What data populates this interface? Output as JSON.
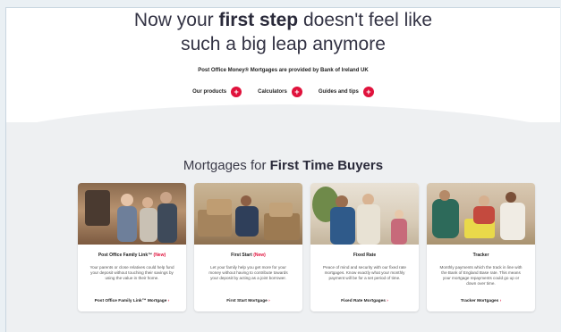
{
  "hero": {
    "title_part1": "Now your ",
    "title_bold": "first step",
    "title_part2": " doesn't feel like",
    "title_line2": "such a big leap anymore",
    "subtitle": "Post Office Money® Mortgages are provided by Bank of Ireland UK"
  },
  "links": [
    {
      "label": "Our products",
      "icon": "plus-icon"
    },
    {
      "label": "Calculators",
      "icon": "plus-icon"
    },
    {
      "label": "Guides and tips",
      "icon": "plus-icon"
    }
  ],
  "section": {
    "title_part1": "Mortgages for ",
    "title_bold": "First Time Buyers"
  },
  "cards": [
    {
      "title": "Post Office Family Link™",
      "tag": "(New)",
      "text": "Your parents or close relatives could help fund your deposit without touching their savings by using the value in their home.",
      "link": "Post Office Family Link™ Mortgage",
      "arrow": "›"
    },
    {
      "title": "First Start",
      "tag": "(New)",
      "text": "Let your family help you get more for your money without having to contribute towards your deposit by acting as a joint borrower.",
      "link": "First Start Mortgage",
      "arrow": "›"
    },
    {
      "title": "Fixed Rate",
      "tag": "",
      "text": "Peace of mind and security with our fixed rate mortgages. Know exactly what your monthly payment will be for a set period of time.",
      "link": "Fixed Rate Mortgages",
      "arrow": "›"
    },
    {
      "title": "Tracker",
      "tag": "",
      "text": "Monthly payments which the track in line with the Bank of England Base rate. This means your mortgage repayments could go up or down over time.",
      "link": "Tracker Mortgages",
      "arrow": "›"
    }
  ],
  "colors": {
    "accent": "#e0123c",
    "section_bg": "#eef0f2"
  }
}
